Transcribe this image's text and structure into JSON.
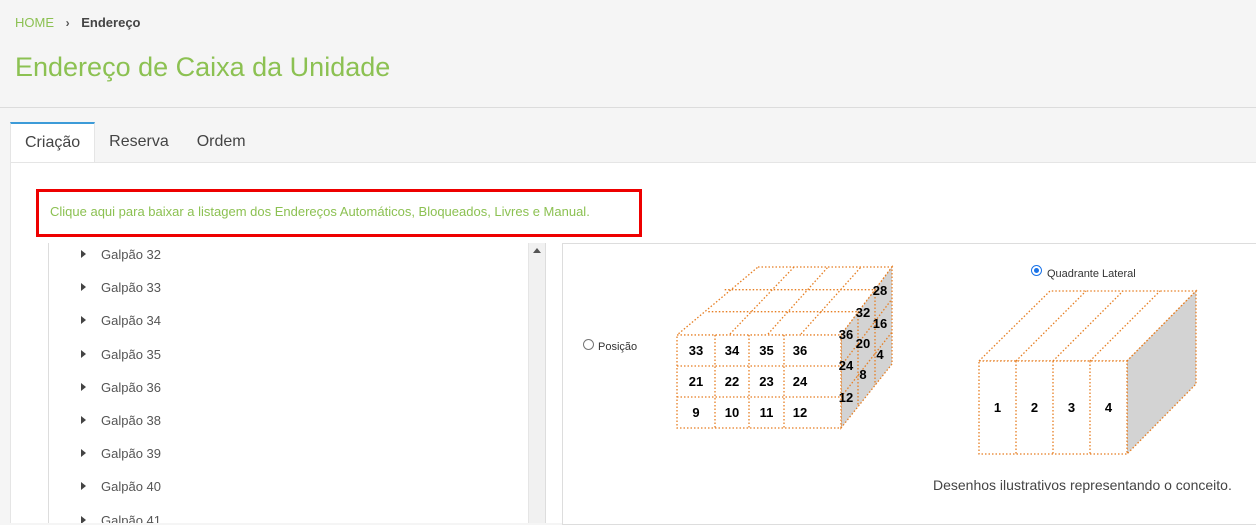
{
  "breadcrumb": {
    "home": "HOME",
    "separator": "›",
    "current": "Endereço"
  },
  "page_title": "Endereço de Caixa da Unidade",
  "tabs": [
    {
      "label": "Criação",
      "active": true
    },
    {
      "label": "Reserva",
      "active": false
    },
    {
      "label": "Ordem",
      "active": false
    }
  ],
  "download_link": "Clique aqui para baixar a listagem dos Endereços Automáticos, Bloqueados, Livres e Manual.",
  "tree_items": [
    "Galpão 32",
    "Galpão 33",
    "Galpão 34",
    "Galpão 35",
    "Galpão 36",
    "Galpão 38",
    "Galpão 39",
    "Galpão 40",
    "Galpão 41"
  ],
  "options": {
    "posicao": {
      "label": "Posição",
      "checked": false
    },
    "quadrante": {
      "label": "Quadrante Lateral",
      "checked": true
    }
  },
  "cube": {
    "front_rows": [
      [
        "33",
        "34",
        "35",
        "36"
      ],
      [
        "21",
        "22",
        "23",
        "24"
      ],
      [
        "9",
        "10",
        "11",
        "12"
      ]
    ],
    "side_labels": [
      "28",
      "32",
      "16",
      "36",
      "20",
      "4",
      "24",
      "8",
      "12"
    ]
  },
  "lateral": {
    "labels": [
      "1",
      "2",
      "3",
      "4"
    ]
  },
  "caption": "Desenhos ilustrativos representando o conceito.",
  "colors": {
    "accent": "#8cc152",
    "highlight_border": "#e00000",
    "tab_active": "#3d9bd8",
    "dotted": "#e67e22",
    "side_fill": "#d3d3d3"
  }
}
